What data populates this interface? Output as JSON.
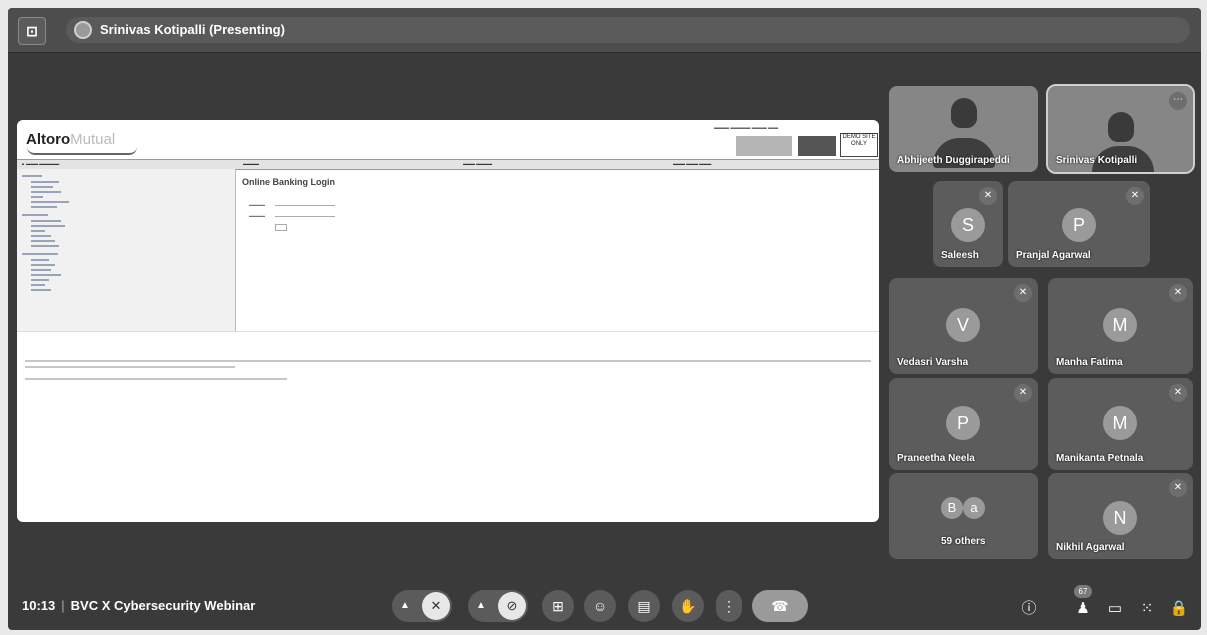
{
  "presenter": {
    "name": "Srinivas Kotipalli (Presenting)"
  },
  "meeting": {
    "time": "10:13",
    "separator": "|",
    "title": "BVC X Cybersecurity Webinar"
  },
  "shared_screen": {
    "logo_bold": "Altoro",
    "logo_light": "Mutual",
    "demo_label": "DEMO SITE ONLY",
    "page_title": "Online Banking Login"
  },
  "participants": {
    "video": [
      {
        "name": "Abhijeeth Duggirapeddi"
      },
      {
        "name": "Srinivas Kotipalli"
      }
    ],
    "tiles": [
      {
        "initial": "S",
        "name": "Saleesh"
      },
      {
        "initial": "P",
        "name": "Pranjal Agarwal"
      },
      {
        "initial": "V",
        "name": "Vedasri Varsha"
      },
      {
        "initial": "M",
        "name": "Manha Fatima"
      },
      {
        "initial": "P",
        "name": "Praneetha Neela"
      },
      {
        "initial": "M",
        "name": "Manikanta Petnala"
      },
      {
        "initial": "N",
        "name": "Nikhil Agarwal"
      }
    ],
    "others": {
      "initial_1": "B",
      "initial_2": "a",
      "label": "59 others"
    },
    "count_badge": "67"
  },
  "icons": {
    "app": "present-frame-icon",
    "mic": "mic-off-icon",
    "camera": "camera-off-icon",
    "present": "present-screen-icon",
    "emoji": "emoji-icon",
    "captions": "captions-icon",
    "hand": "raise-hand-icon",
    "more": "more-vert-icon",
    "end": "end-call-icon",
    "info": "info-icon",
    "people": "people-icon",
    "chat": "chat-icon",
    "activities": "activities-icon",
    "lock": "host-controls-icon"
  }
}
